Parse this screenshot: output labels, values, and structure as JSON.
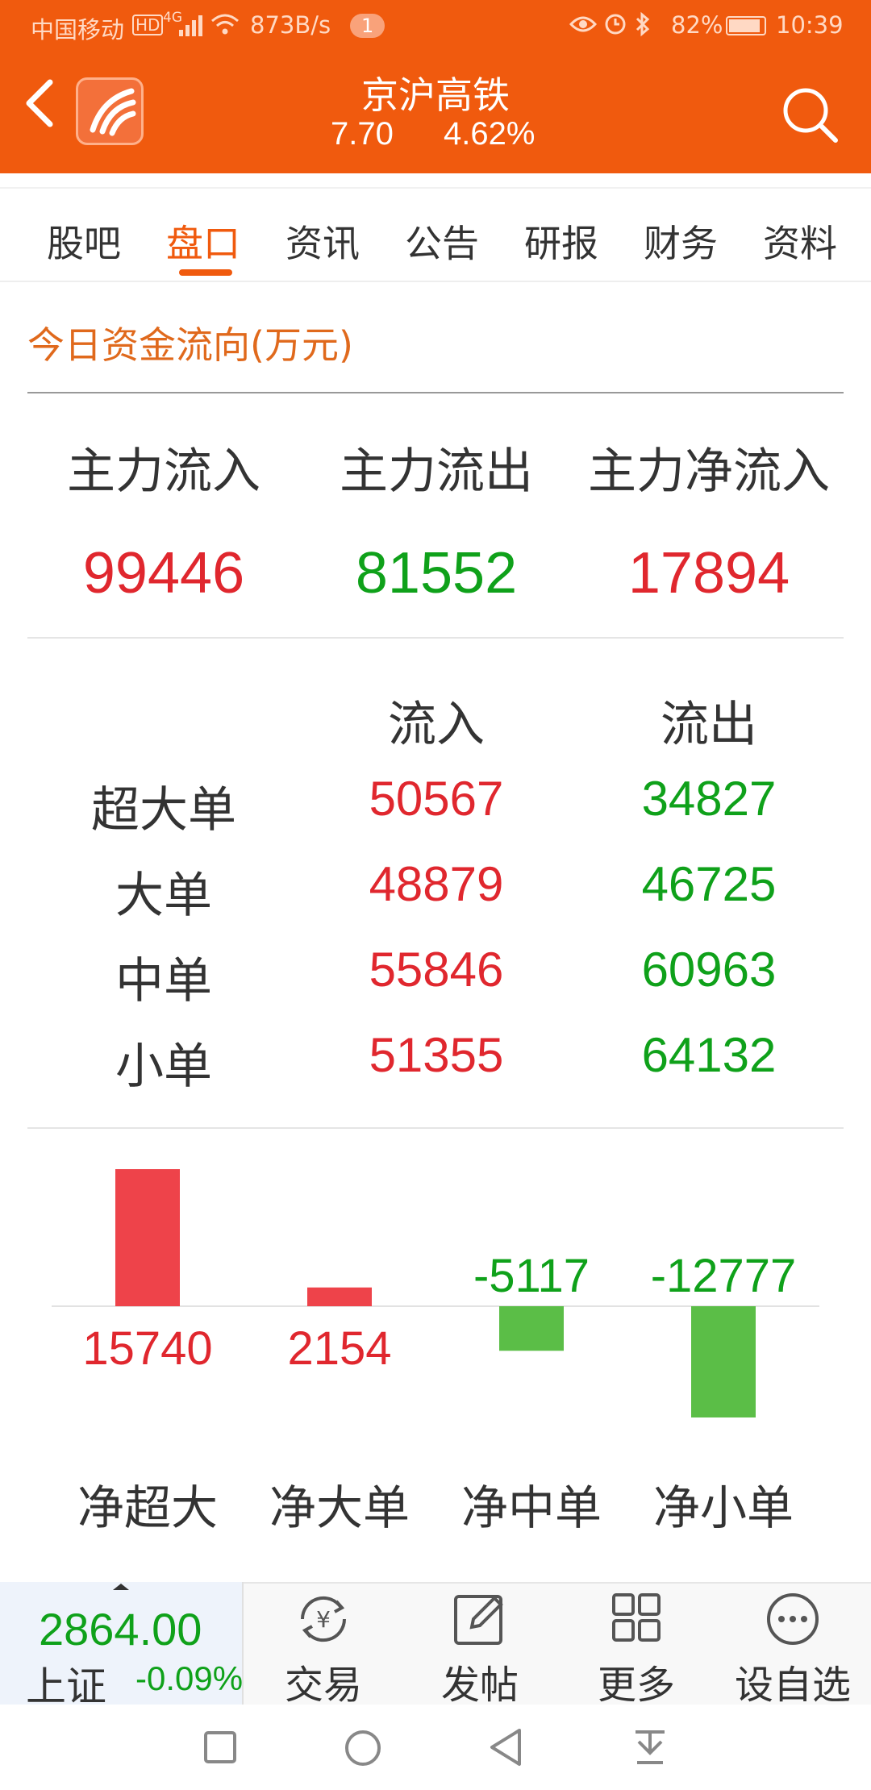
{
  "status_bar": {
    "carrier": "中国移动",
    "hd": "HD",
    "signal": "4G",
    "speed": "873B/s",
    "badge": "1",
    "battery": "82%",
    "time": "10:39"
  },
  "header": {
    "title": "京沪高铁",
    "price": "7.70",
    "change_pct": "4.62%"
  },
  "tabs": [
    {
      "label": "股吧",
      "active": false
    },
    {
      "label": "盘口",
      "active": true
    },
    {
      "label": "资讯",
      "active": false
    },
    {
      "label": "公告",
      "active": false
    },
    {
      "label": "研报",
      "active": false
    },
    {
      "label": "财务",
      "active": false
    },
    {
      "label": "资料",
      "active": false
    }
  ],
  "fund_flow": {
    "section_title": "今日资金流向(万元)",
    "summary": [
      {
        "label": "主力流入",
        "value": "99446",
        "tone": "red"
      },
      {
        "label": "主力流出",
        "value": "81552",
        "tone": "green"
      },
      {
        "label": "主力净流入",
        "value": "17894",
        "tone": "red"
      }
    ],
    "table": {
      "col_in": "流入",
      "col_out": "流出",
      "rows": [
        {
          "label": "超大单",
          "in": "50567",
          "out": "34827"
        },
        {
          "label": "大单",
          "in": "48879",
          "out": "46725"
        },
        {
          "label": "中单",
          "in": "55846",
          "out": "60963"
        },
        {
          "label": "小单",
          "in": "51355",
          "out": "64132"
        }
      ]
    }
  },
  "chart_data": {
    "type": "bar",
    "categories": [
      "净超大",
      "净大单",
      "净中单",
      "净小单"
    ],
    "values": [
      15740,
      2154,
      -5117,
      -12777
    ],
    "labels": [
      "15740",
      "2154",
      "-5117",
      "-12777"
    ],
    "colors": {
      "positive": "#EE434A",
      "negative": "#5BBE47"
    }
  },
  "bottom_bar": {
    "index_value": "2864.00",
    "index_name": "上证",
    "index_change": "-0.09%",
    "buttons": [
      {
        "label": "交易",
        "icon": "yen-refresh-icon"
      },
      {
        "label": "发帖",
        "icon": "edit-icon"
      },
      {
        "label": "更多",
        "icon": "grid-icon"
      },
      {
        "label": "设自选",
        "icon": "more-circle-icon"
      }
    ]
  }
}
